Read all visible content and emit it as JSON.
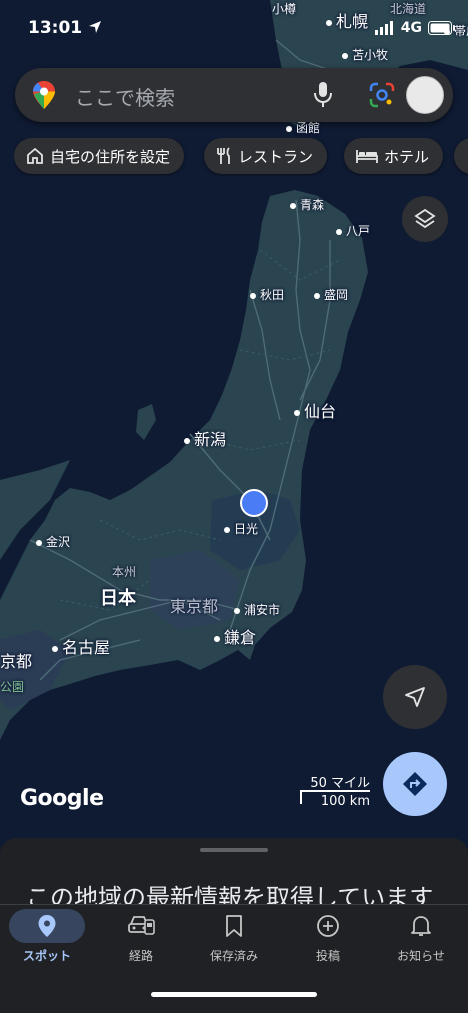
{
  "status_bar": {
    "time": "13:01",
    "network": "4G"
  },
  "search": {
    "placeholder": "ここで検索"
  },
  "chips": [
    "自宅の住所を設定",
    "レストラン",
    "ホテル"
  ],
  "map_labels": {
    "otaru": "小樽",
    "sapporo": "札幌",
    "hokkaido": "北海道",
    "obihiro": "帯広",
    "tomakomai": "苫小牧",
    "hakodate": "函館",
    "aomori": "青森",
    "hachinohe": "八戸",
    "akita": "秋田",
    "morioka": "盛岡",
    "sendai": "仙台",
    "niigata": "新潟",
    "nikko": "日光",
    "kanazawa": "金沢",
    "honshu": "本州",
    "nihon": "日本",
    "tokyo": "東京都",
    "urayasu": "浦安市",
    "kamakura": "鎌倉",
    "nagoya": "名古屋",
    "kyoto": "京都",
    "park": "公園"
  },
  "google_logo": "Google",
  "scale": {
    "miles": "50 マイル",
    "km": "100 km"
  },
  "sheet": {
    "message": "この地域の最新情報を取得しています"
  },
  "nav": [
    {
      "label": "スポット",
      "icon": "location-pin-icon",
      "active": true
    },
    {
      "label": "経路",
      "icon": "car-icon",
      "active": false
    },
    {
      "label": "保存済み",
      "icon": "bookmark-icon",
      "active": false
    },
    {
      "label": "投稿",
      "icon": "add-circle-icon",
      "active": false
    },
    {
      "label": "お知らせ",
      "icon": "bell-icon",
      "active": false
    }
  ],
  "colors": {
    "ocean": "#0f1b33",
    "land": "#2a4450",
    "land_dark": "#213844",
    "location_dot": "#4a7df5",
    "directions_button": "#a8c7fa",
    "surface": "#2f3033",
    "nav_active": "#a8c7fa"
  }
}
